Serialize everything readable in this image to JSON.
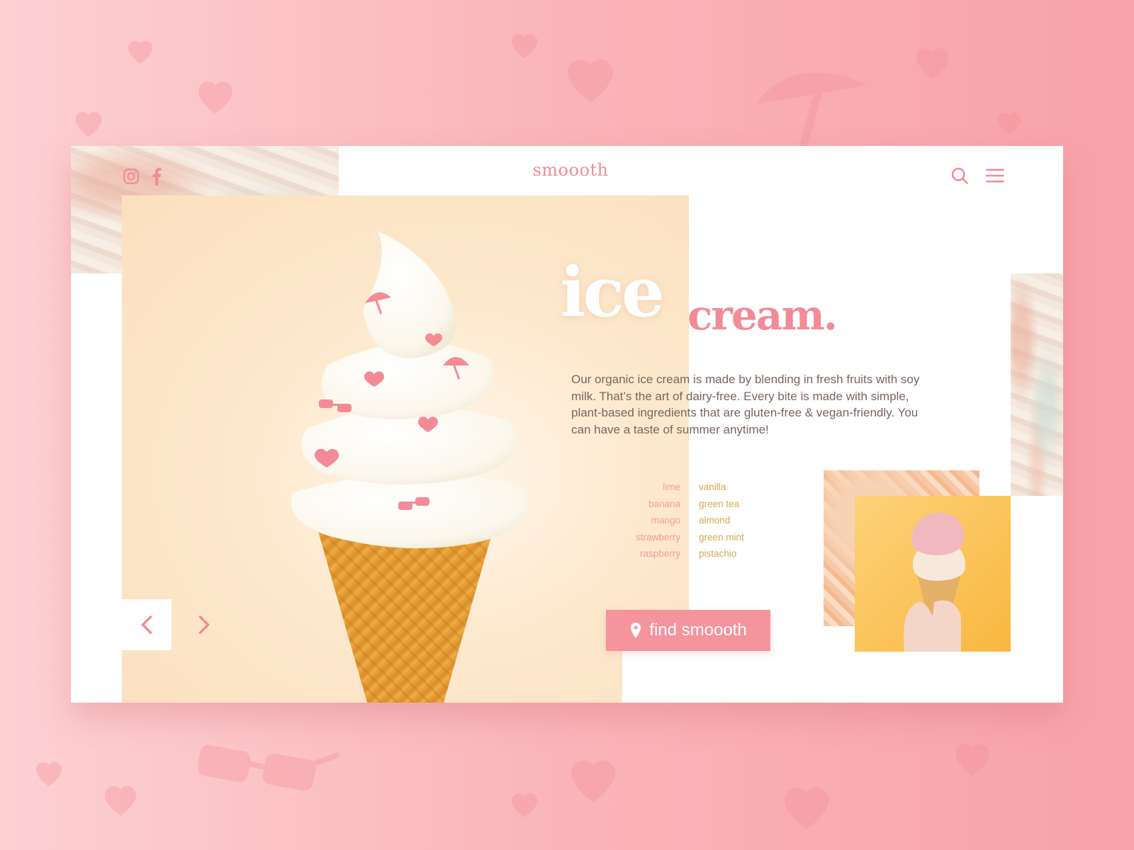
{
  "brand": {
    "name": "smoooth"
  },
  "header": {
    "search_icon": "search-icon",
    "menu_icon": "hamburger-menu-icon"
  },
  "social": {
    "instagram_icon": "instagram-icon",
    "facebook_icon": "facebook-icon"
  },
  "headline": {
    "word1": "ice",
    "word2": "cream."
  },
  "description": "Our organic ice cream is made by blending in fresh fruits with soy milk. That’s the art of dairy-free. Every bite is made with simple, plant-based ingredients that are gluten-free & vegan-friendly. You can have a taste of summer anytime!",
  "flavors": {
    "fruits": [
      "lime",
      "banana",
      "mango",
      "strawberry",
      "raspberry"
    ],
    "classics": [
      "vanilla",
      "green tea",
      "almond",
      "green mint",
      "pistachio"
    ]
  },
  "cta": {
    "label": "find smoooth",
    "icon": "location-pin-icon"
  },
  "carousel": {
    "prev_icon": "chevron-left-icon",
    "next_icon": "chevron-right-icon"
  },
  "colors": {
    "accent": "#f5949c",
    "background": "#fab4b9",
    "flavor_fruit": "#f49aa3",
    "flavor_classic": "#d4a84a"
  }
}
